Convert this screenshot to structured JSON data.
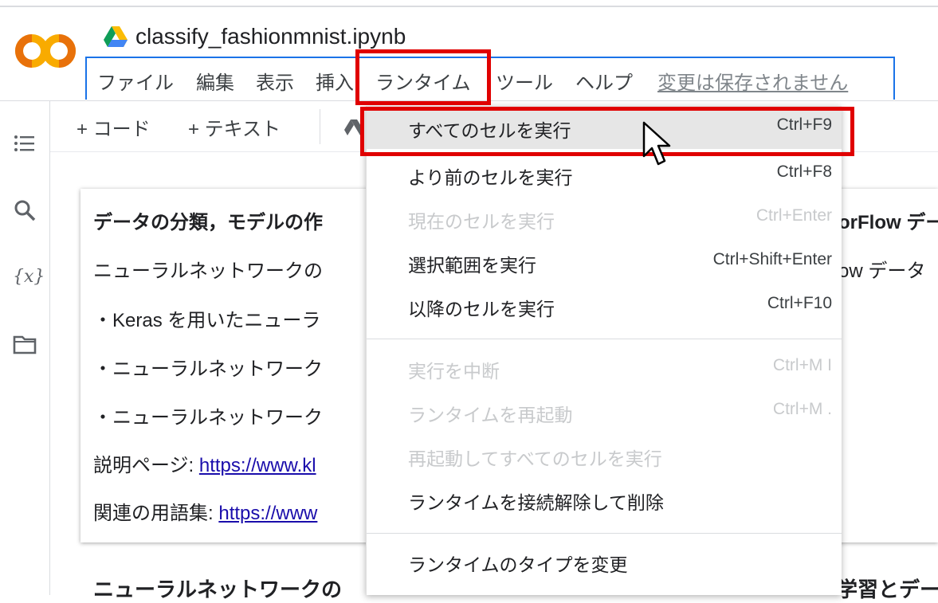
{
  "app": {
    "title": "classify_fashionmnist.ipynb",
    "logo_text": "CO"
  },
  "menubar": {
    "items": [
      "ファイル",
      "編集",
      "表示",
      "挿入",
      "ランタイム",
      "ツール",
      "ヘルプ"
    ],
    "unsaved_label": "変更は保存されません"
  },
  "toolbar": {
    "add_code": "+ コード",
    "add_text": "+ テキスト"
  },
  "cell": {
    "heading": "データの分類，モデルの作",
    "line1": "ニューラルネットワークの",
    "bullet1": "・Keras を用いたニューラ",
    "bullet2": "・ニューラルネットワーク",
    "bullet3": "・ニューラルネットワーク",
    "desc_label": "説明ページ: ",
    "desc_link": "https://www.kl",
    "glossary_label": "関連の用語集: ",
    "glossary_link": "https://www",
    "right_heading": "orFlow デー",
    "right_line1": "ow データ"
  },
  "next_cell": {
    "heading_left": "ニューラルネットワークの",
    "heading_right": "学習とデー"
  },
  "dropdown": {
    "items": [
      {
        "label": "すべてのセルを実行",
        "shortcut": "Ctrl+F9",
        "state": "hovered"
      },
      {
        "label": "より前のセルを実行",
        "shortcut": "Ctrl+F8",
        "state": "enabled"
      },
      {
        "label": "現在のセルを実行",
        "shortcut": "Ctrl+Enter",
        "state": "disabled"
      },
      {
        "label": "選択範囲を実行",
        "shortcut": "Ctrl+Shift+Enter",
        "state": "enabled"
      },
      {
        "label": "以降のセルを実行",
        "shortcut": "Ctrl+F10",
        "state": "enabled"
      },
      {
        "label": "実行を中断",
        "shortcut": "Ctrl+M I",
        "state": "disabled"
      },
      {
        "label": "ランタイムを再起動",
        "shortcut": "Ctrl+M .",
        "state": "disabled"
      },
      {
        "label": "再起動してすべてのセルを実行",
        "shortcut": "",
        "state": "disabled"
      },
      {
        "label": "ランタイムを接続解除して削除",
        "shortcut": "",
        "state": "enabled"
      },
      {
        "label": "ランタイムのタイプを変更",
        "shortcut": "",
        "state": "enabled"
      }
    ]
  },
  "colors": {
    "highlight": "#e00000",
    "accent": "#1a73e8",
    "logo_orange": "#f9ab00",
    "logo_dark_orange": "#e8710a"
  },
  "icons": {
    "sidebar": [
      "toc-icon",
      "search-icon",
      "variables-icon",
      "folder-icon"
    ]
  }
}
